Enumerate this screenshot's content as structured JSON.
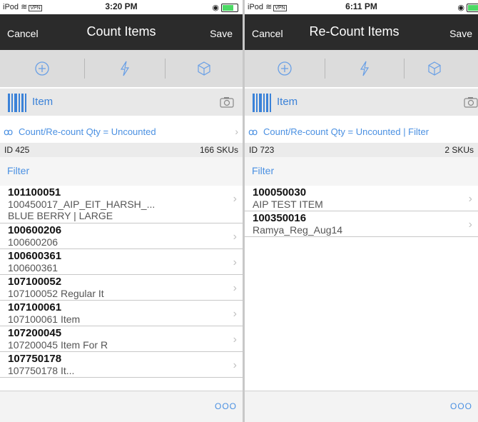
{
  "left": {
    "status": {
      "device": "iPod",
      "vpn": "VPN",
      "time": "3:20 PM"
    },
    "nav": {
      "cancel": "Cancel",
      "title": "Count Items",
      "save": "Save"
    },
    "item_label": "Item",
    "filter_summary": "Count/Re-count Qty = Uncounted",
    "id": "ID 425",
    "skus": "166 SKUs",
    "filter_label": "Filter",
    "rows": [
      {
        "code": "101100051",
        "d1": "100450017_AIP_EIT_HARSH_...",
        "d2": "BLUE BERRY | LARGE"
      },
      {
        "code": "100600206",
        "d1": "100600206"
      },
      {
        "code": "100600361",
        "d1": "100600361"
      },
      {
        "code": "107100052",
        "d1": "107100052 Regular It"
      },
      {
        "code": "107100061",
        "d1": "107100061 Item"
      },
      {
        "code": "107200045",
        "d1": "107200045 Item For R"
      },
      {
        "code": "107750178",
        "d1": "107750178 It..."
      }
    ],
    "more": "OOO"
  },
  "right": {
    "status": {
      "device": "iPod",
      "vpn": "VPN",
      "time": "6:11 PM"
    },
    "nav": {
      "cancel": "Cancel",
      "title": "Re-Count Items",
      "save": "Save"
    },
    "item_label": "Item",
    "filter_summary": "Count/Re-count Qty = Uncounted | Filter",
    "id": "ID 723",
    "skus": "2 SKUs",
    "filter_label": "Filter",
    "rows": [
      {
        "code": "100050030",
        "d1": "AIP TEST ITEM"
      },
      {
        "code": "100350016",
        "d1": "Ramya_Reg_Aug14"
      }
    ],
    "more": "OOO"
  },
  "icons": {
    "add": "plus-circle-icon",
    "quick": "lightning-icon",
    "package": "box-icon",
    "barcode": "barcode-icon",
    "camera": "camera-icon",
    "glasses": "glasses-icon",
    "chevron": "chevron-right-icon"
  },
  "colors": {
    "nav_bg": "#2b2b2b",
    "accent": "#4a90e2",
    "toolbar_bg": "#dcdcdc"
  }
}
